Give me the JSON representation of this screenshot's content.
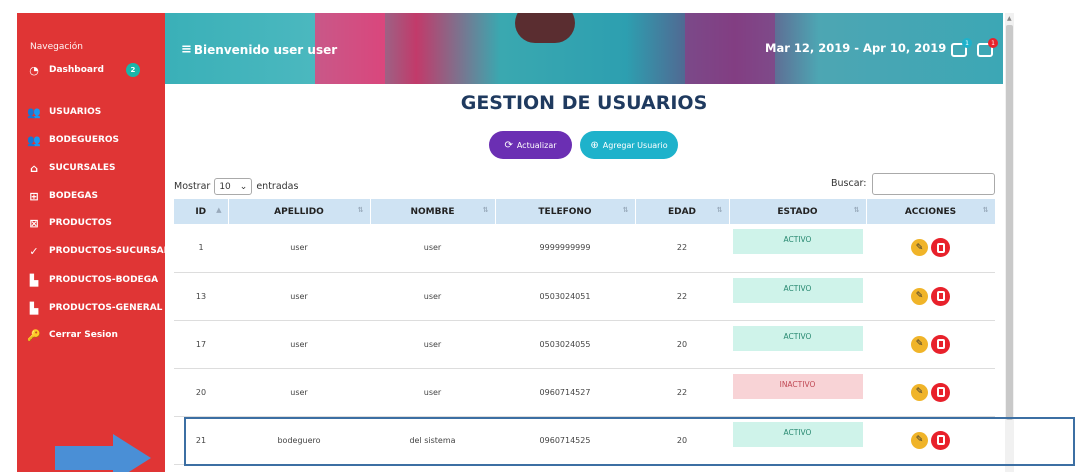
{
  "sidebar": {
    "heading": "Navegación",
    "dashboard": {
      "label": "Dashboard",
      "badge": "2"
    },
    "items": [
      {
        "label": "USUARIOS",
        "icon": "users-icon"
      },
      {
        "label": "BODEGUEROS",
        "icon": "users-icon"
      },
      {
        "label": "SUCURSALES",
        "icon": "home-icon"
      },
      {
        "label": "BODEGAS",
        "icon": "grid-icon"
      },
      {
        "label": "PRODUCTOS",
        "icon": "box-icon"
      },
      {
        "label": "PRODUCTOS-SUCURSAL",
        "icon": "check-icon"
      },
      {
        "label": "PRODUCTOS-BODEGA",
        "icon": "factory-icon"
      },
      {
        "label": "PRODUCTOS-GENERAL",
        "icon": "factory-icon"
      },
      {
        "label": "Cerrar Sesion",
        "icon": "key-icon"
      }
    ]
  },
  "header": {
    "welcome": "Bienvenido user user",
    "daterange": "Mar 12, 2019 - Apr 10, 2019",
    "notif_badge_1": "1",
    "notif_badge_2": "1"
  },
  "main": {
    "title": "GESTION DE USUARIOS",
    "refresh_label": "Actualizar",
    "add_label": "Agregar Usuario",
    "show_label": "Mostrar",
    "show_value": "10",
    "entries_label": "entradas",
    "search_label": "Buscar:"
  },
  "table": {
    "columns": [
      "ID",
      "APELLIDO",
      "NOMBRE",
      "TELEFONO",
      "EDAD",
      "ESTADO",
      "ACCIONES"
    ],
    "rows": [
      {
        "id": "1",
        "apellido": "user",
        "nombre": "user",
        "telefono": "9999999999",
        "edad": "22",
        "estado": "ACTIVO"
      },
      {
        "id": "13",
        "apellido": "user",
        "nombre": "user",
        "telefono": "0503024051",
        "edad": "22",
        "estado": "ACTIVO"
      },
      {
        "id": "17",
        "apellido": "user",
        "nombre": "user",
        "telefono": "0503024055",
        "edad": "20",
        "estado": "ACTIVO"
      },
      {
        "id": "20",
        "apellido": "user",
        "nombre": "user",
        "telefono": "0960714527",
        "edad": "22",
        "estado": "INACTIVO"
      },
      {
        "id": "21",
        "apellido": "bodeguero",
        "nombre": "del sistema",
        "telefono": "0960714525",
        "edad": "20",
        "estado": "ACTIVO"
      }
    ]
  },
  "colors": {
    "sidebar": "#e03535",
    "accent_purple": "#6b2fb3",
    "accent_cyan": "#1eb2cb",
    "title": "#1f3a5f"
  }
}
